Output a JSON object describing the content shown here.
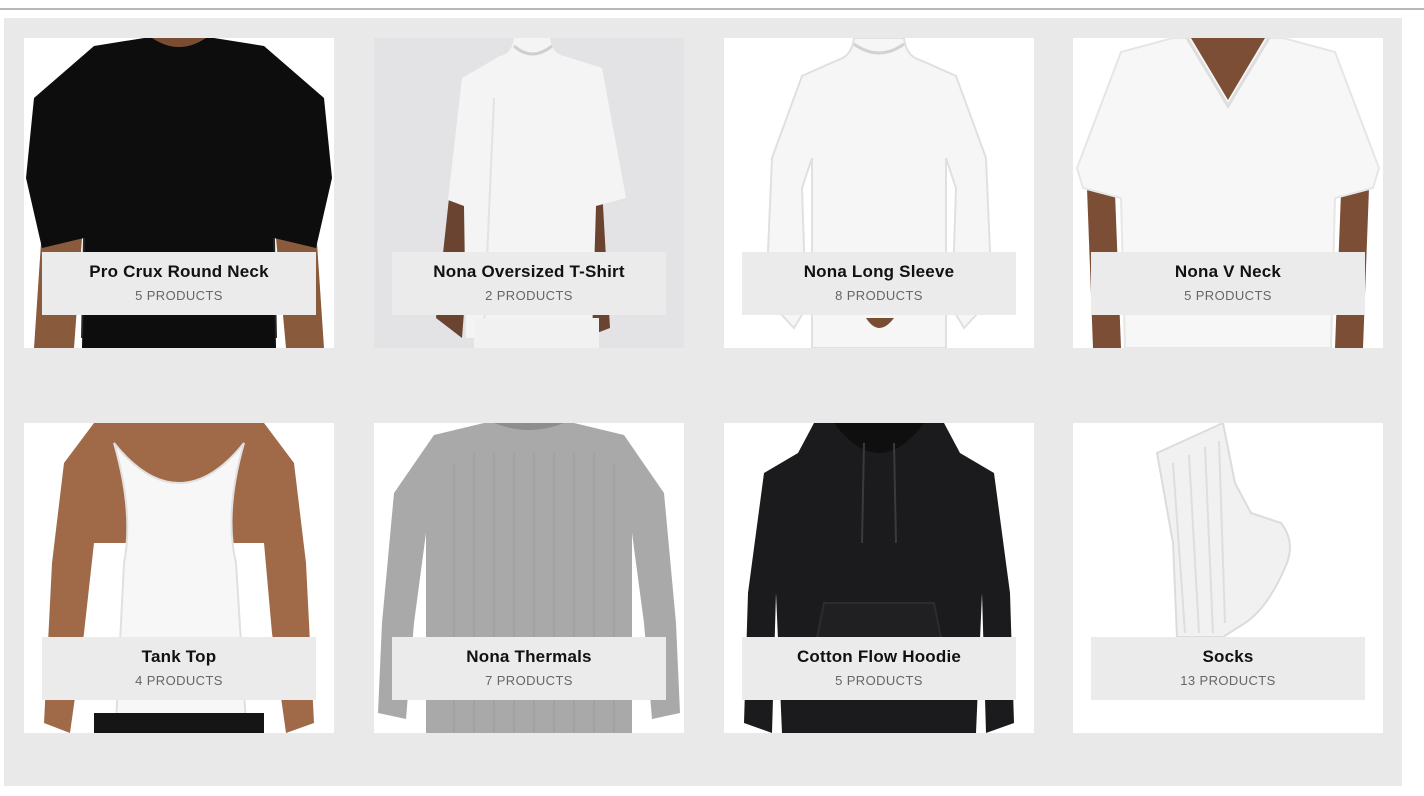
{
  "categories": [
    {
      "name": "Pro Crux Round Neck",
      "count": "5 PRODUCTS",
      "icon": "black-tshirt-image"
    },
    {
      "name": "Nona Oversized T-Shirt",
      "count": "2 PRODUCTS",
      "icon": "white-oversized-tshirt-image"
    },
    {
      "name": "Nona Long Sleeve",
      "count": "8 PRODUCTS",
      "icon": "white-long-sleeve-image"
    },
    {
      "name": "Nona V Neck",
      "count": "5 PRODUCTS",
      "icon": "white-v-neck-image"
    },
    {
      "name": "Tank Top",
      "count": "4 PRODUCTS",
      "icon": "white-tank-top-image"
    },
    {
      "name": "Nona Thermals",
      "count": "7 PRODUCTS",
      "icon": "grey-thermal-image"
    },
    {
      "name": "Cotton Flow Hoodie",
      "count": "5 PRODUCTS",
      "icon": "black-hoodie-image"
    },
    {
      "name": "Socks",
      "count": "13 PRODUCTS",
      "icon": "white-sock-image"
    }
  ],
  "colors": {
    "panel_bg": "#e9e9e9",
    "label_bg": "#ebebeb",
    "title_text": "#111111",
    "count_text": "#666666"
  }
}
